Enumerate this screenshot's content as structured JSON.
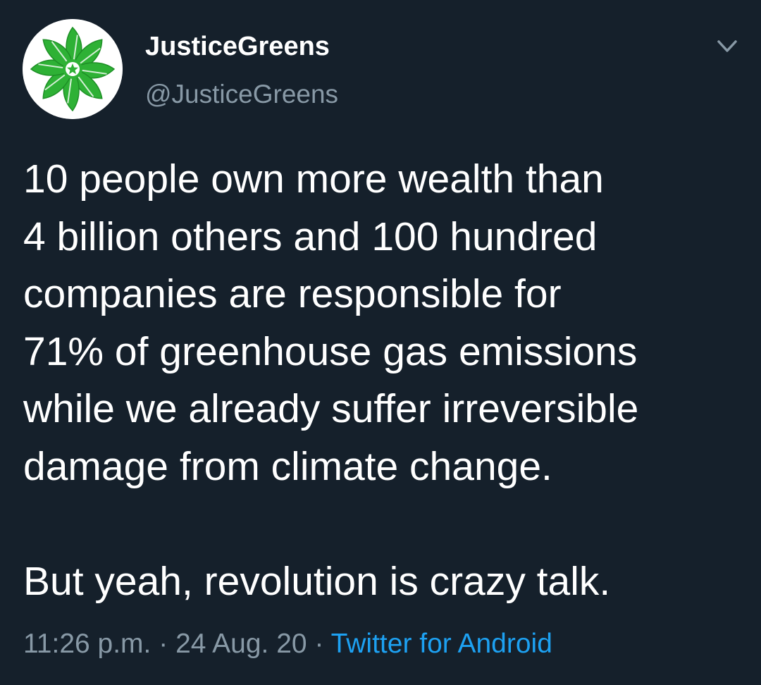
{
  "user": {
    "display_name": "JusticeGreens",
    "handle": "@JusticeGreens",
    "avatar_icon": "green-flower-star-logo"
  },
  "tweet": {
    "lines": [
      "10 people own more wealth than",
      "4 billion others and 100 hundred",
      "companies are responsible for",
      "71% of greenhouse gas emissions",
      "while we already suffer irreversible",
      "damage from climate change."
    ],
    "closing_line": "But yeah, revolution is crazy talk."
  },
  "meta": {
    "time": "11:26 p.m.",
    "separator": "·",
    "date": "24 Aug. 20",
    "source": "Twitter for Android"
  },
  "colors": {
    "background": "#15202b",
    "primary_text": "#ffffff",
    "secondary_text": "#8899a6",
    "link": "#1da1f2",
    "logo_green": "#2eb135"
  }
}
